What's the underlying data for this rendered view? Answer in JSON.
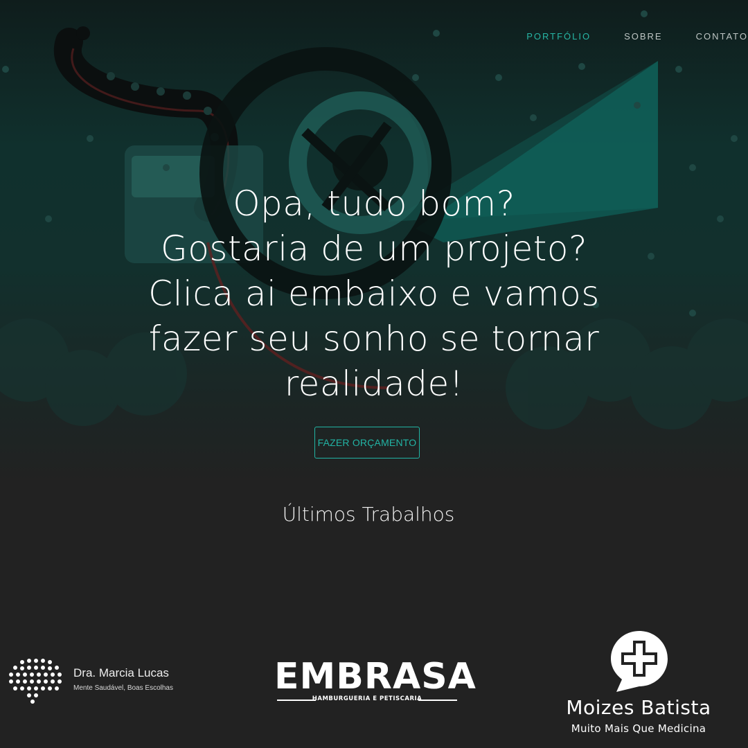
{
  "nav": {
    "items": [
      {
        "label": "PORTFÓLIO"
      },
      {
        "label": "SOBRE"
      },
      {
        "label": "CONTATO"
      }
    ]
  },
  "hero": {
    "lines": [
      "Opa, tudo bom?",
      "Gostaria de um projeto?",
      "Clica ai embaixo e vamos",
      "fazer seu sonho se tornar",
      "realidade!"
    ],
    "cta_label": "FAZER ORÇAMENTO"
  },
  "section": {
    "title": "Últimos Trabalhos"
  },
  "clients": {
    "marcia": {
      "name": "Dra. Marcia Lucas",
      "tagline": "Mente Saudável, Boas Escolhas"
    },
    "embrasa": {
      "name": "EMBRASA",
      "tagline": "HAMBURGUERIA E PETISCARIA"
    },
    "moizes": {
      "name": "Moizes Batista",
      "tagline": "Muito Mais Que Medicina"
    }
  },
  "colors": {
    "accent": "#27b6a5",
    "background": "#222222",
    "hero_dark": "#0f1d1c"
  }
}
